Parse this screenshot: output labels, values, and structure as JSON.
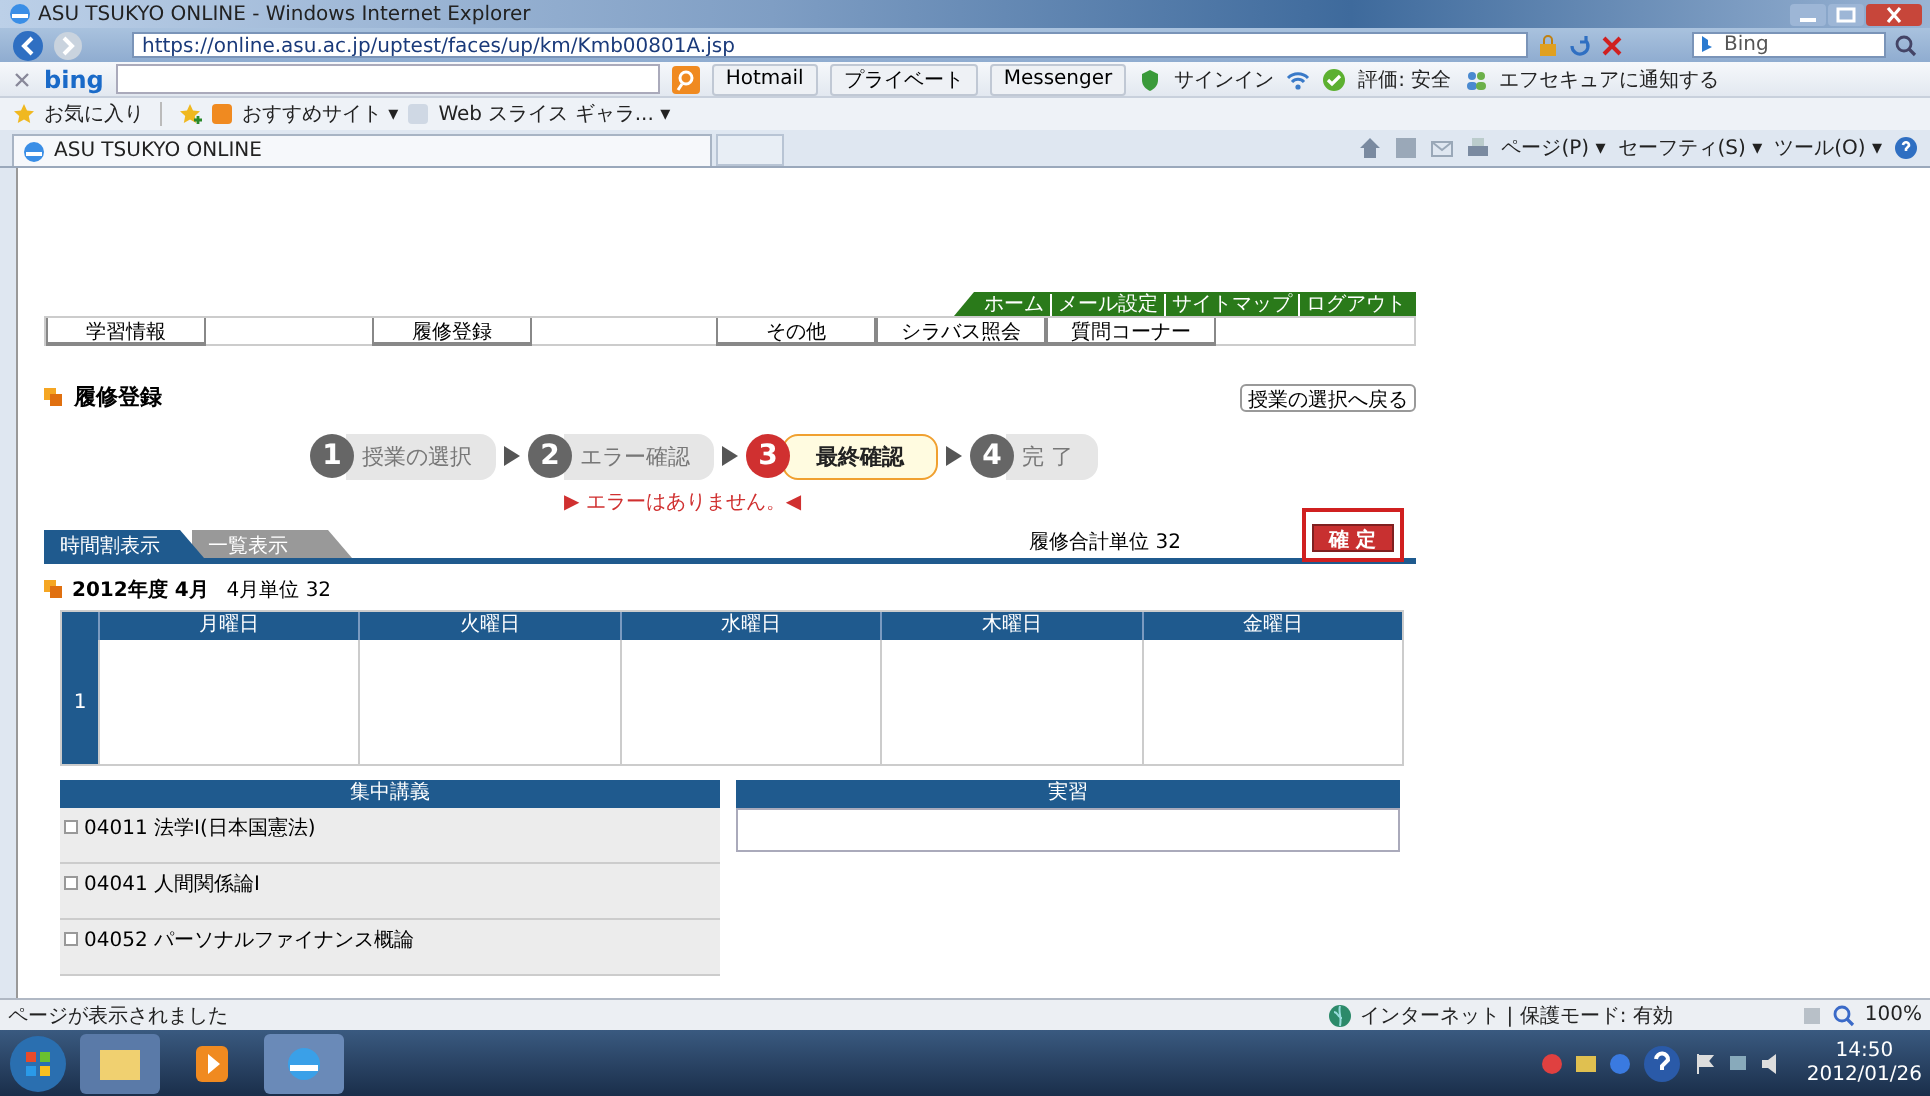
{
  "window": {
    "title": "ASU TSUKYO ONLINE - Windows Internet Explorer"
  },
  "address_bar": {
    "url": "https://online.asu.ac.jp/uptest/faces/up/km/Kmb00801A.jsp",
    "search_placeholder": "Bing"
  },
  "bing_toolbar": {
    "logo": "bing",
    "buttons": [
      "Hotmail",
      "プライベート",
      "Messenger"
    ],
    "signin": "サインイン",
    "rating": "評価: 安全",
    "notify": "エフセキュアに通知する"
  },
  "favorites_bar": {
    "favorites": "お気に入り",
    "items": [
      "おすすめサイト ▾",
      "Web スライス ギャラ... ▾"
    ]
  },
  "tab": {
    "title": "ASU TSUKYO ONLINE"
  },
  "commands": [
    "ページ(P) ▾",
    "セーフティ(S) ▾",
    "ツール(O) ▾"
  ],
  "page": {
    "top_links": [
      "ホーム",
      "メール設定",
      "サイトマップ",
      "ログアウト"
    ],
    "nav": [
      "学習情報",
      "履修登録",
      "その他",
      "シラバス照会",
      "質問コーナー"
    ],
    "heading": "履修登録",
    "back_button": "授業の選択へ戻る",
    "steps": [
      {
        "number": "1",
        "label": "授業の選択",
        "selected": false
      },
      {
        "number": "2",
        "label": "エラー確認",
        "selected": false
      },
      {
        "number": "3",
        "label": "最終確認",
        "selected": true
      },
      {
        "number": "4",
        "label": "完 了",
        "selected": false
      }
    ],
    "message": "▶ エラーはありません。◀",
    "view_tabs": [
      {
        "label": "時間割表示",
        "selected": true
      },
      {
        "label": "一覧表示",
        "selected": false
      }
    ],
    "total_units": "履修合計単位 32",
    "confirm_button": "確 定",
    "term": "2012年度 4月",
    "term_units": "4月単位 32",
    "timetable": {
      "days": [
        "月曜日",
        "火曜日",
        "水曜日",
        "木曜日",
        "金曜日"
      ],
      "periods": [
        "1"
      ]
    },
    "intensive": {
      "title": "集中講義",
      "courses": [
        "04011 法学Ⅰ(日本国憲法)",
        "04041 人間関係論Ⅰ",
        "04052 パーソナルファイナンス概論"
      ]
    },
    "practicum": {
      "title": "実習"
    }
  },
  "status_bar": {
    "text": "ページが表示されました",
    "zone": "インターネット | 保護モード: 有効",
    "zoom": "100%"
  },
  "taskbar": {
    "time": "14:50",
    "date": "2012/01/26"
  }
}
